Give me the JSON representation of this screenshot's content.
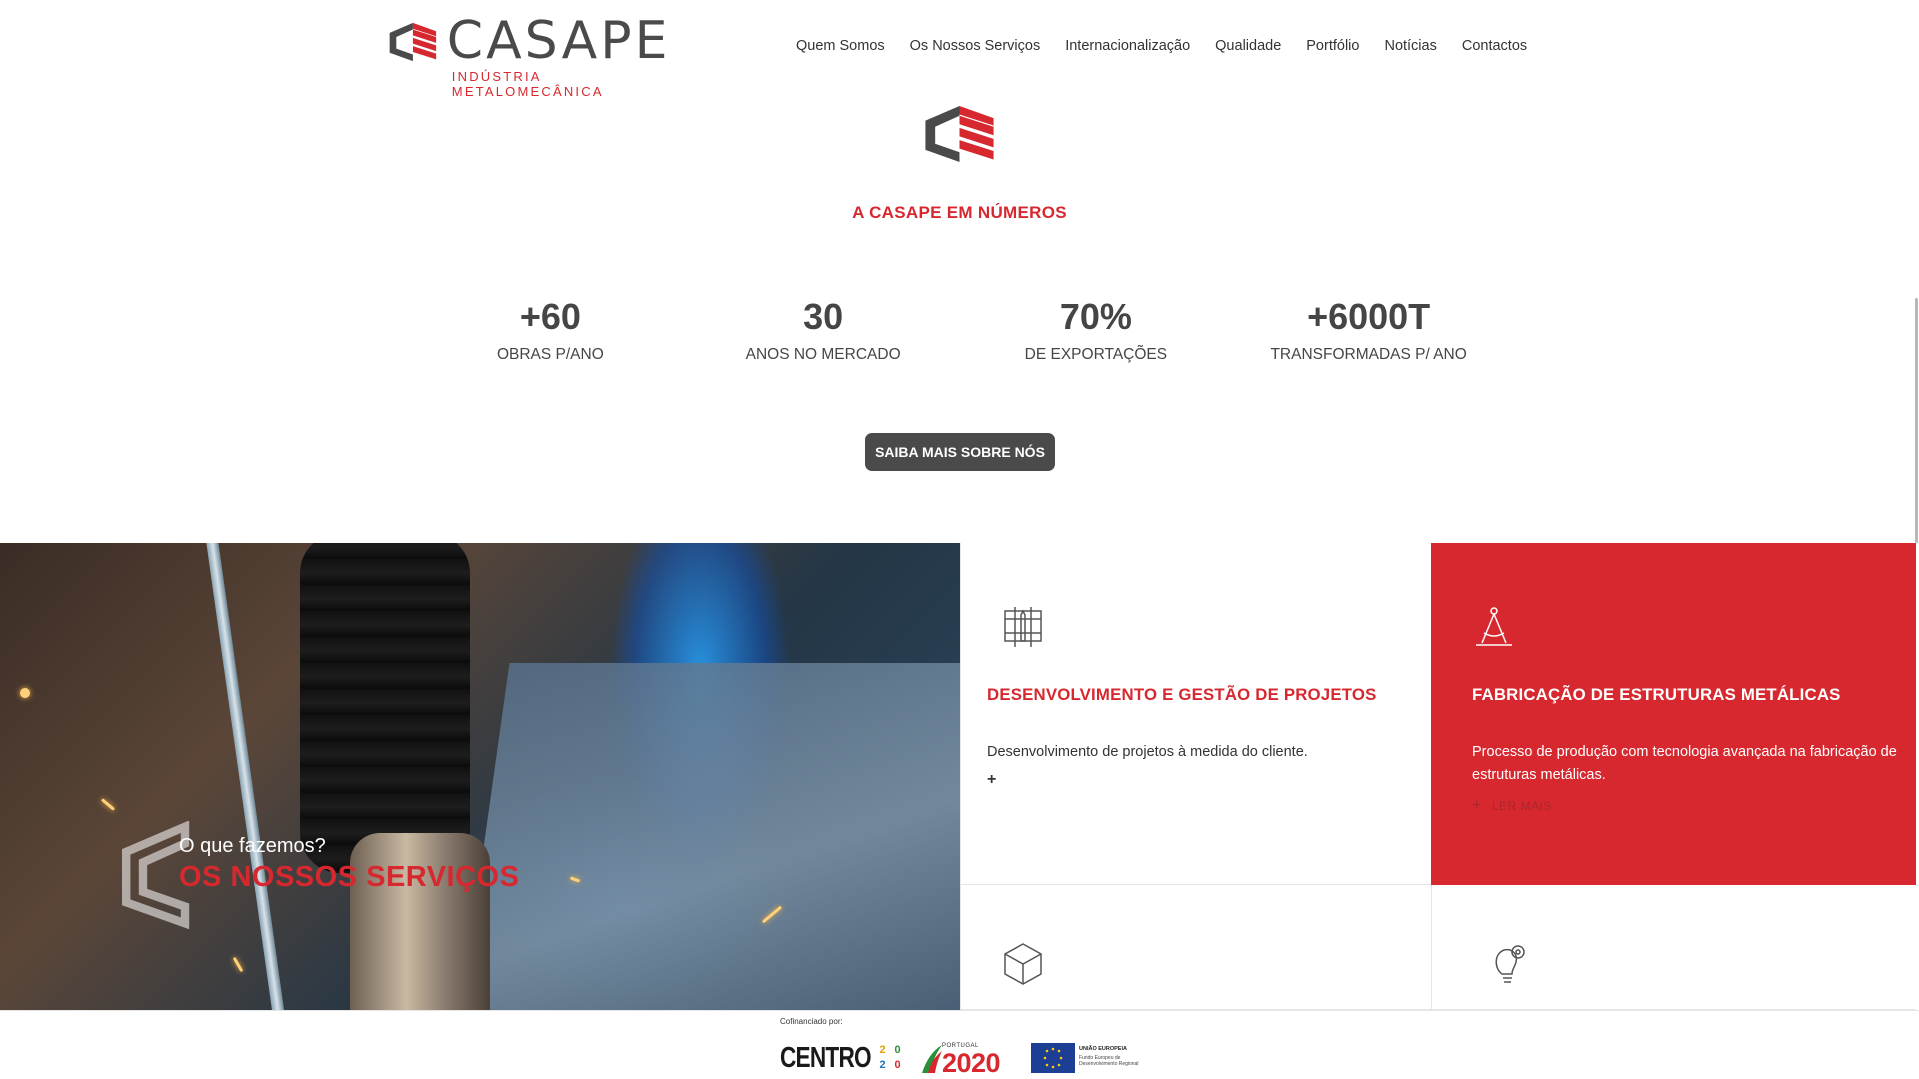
{
  "header": {
    "logo_name": "CASAPE",
    "logo_tagline": "INDÚSTRIA METALOMECÂNICA",
    "nav": [
      "Quem Somos",
      "Os Nossos Serviços",
      "Internacionalização",
      "Qualidade",
      "Portfólio",
      "Notícias",
      "Contactos"
    ]
  },
  "numbers": {
    "title": "A CASAPE EM NÚMEROS",
    "stats": [
      {
        "value": "+60",
        "label": "OBRAS P/ANO"
      },
      {
        "value": "30",
        "label": "ANOS NO MERCADO"
      },
      {
        "value": "70%",
        "label": "DE EXPORTAÇÕES"
      },
      {
        "value": "+6000T",
        "label": "TRANSFORMADAS P/ ANO"
      }
    ],
    "cta_label": "SAIBA MAIS SOBRE NÓS"
  },
  "services": {
    "subtitle": "O que fazemos?",
    "title": "OS NOSSOS SERVIÇOS",
    "cards": [
      {
        "title": "DESENVOLVIMENTO E GESTÃO DE PROJETOS",
        "description": "Desenvolvimento de projetos à medida do cliente.",
        "more_label": "",
        "icon": "blueprint-icon"
      },
      {
        "title": "FABRICAÇÃO DE ESTRUTURAS METÁLICAS",
        "description": "Processo de produção com tecnologia avançada na fabricação de estruturas metálicas.",
        "more_label": "LER MAIS",
        "icon": "compass-icon"
      },
      {
        "title": "",
        "description": "",
        "more_label": "",
        "icon": "cube-icon"
      },
      {
        "title": "",
        "description": "",
        "more_label": "",
        "icon": "lightbulb-gear-icon"
      }
    ]
  },
  "funding": {
    "label": "Cofinanciado por:",
    "centro_text": "CENTRO",
    "centro_digits": [
      "2",
      "0",
      "2",
      "0"
    ],
    "portugal_small": "PORTUGAL",
    "portugal_year": "2020",
    "eu_title": "UNIÃO EUROPEIA",
    "eu_subtitle": "Fundo Europeu de Desenvolvimento Regional"
  },
  "colors": {
    "brand_red": "#d7282f",
    "brand_gray": "#4a4a4a"
  }
}
